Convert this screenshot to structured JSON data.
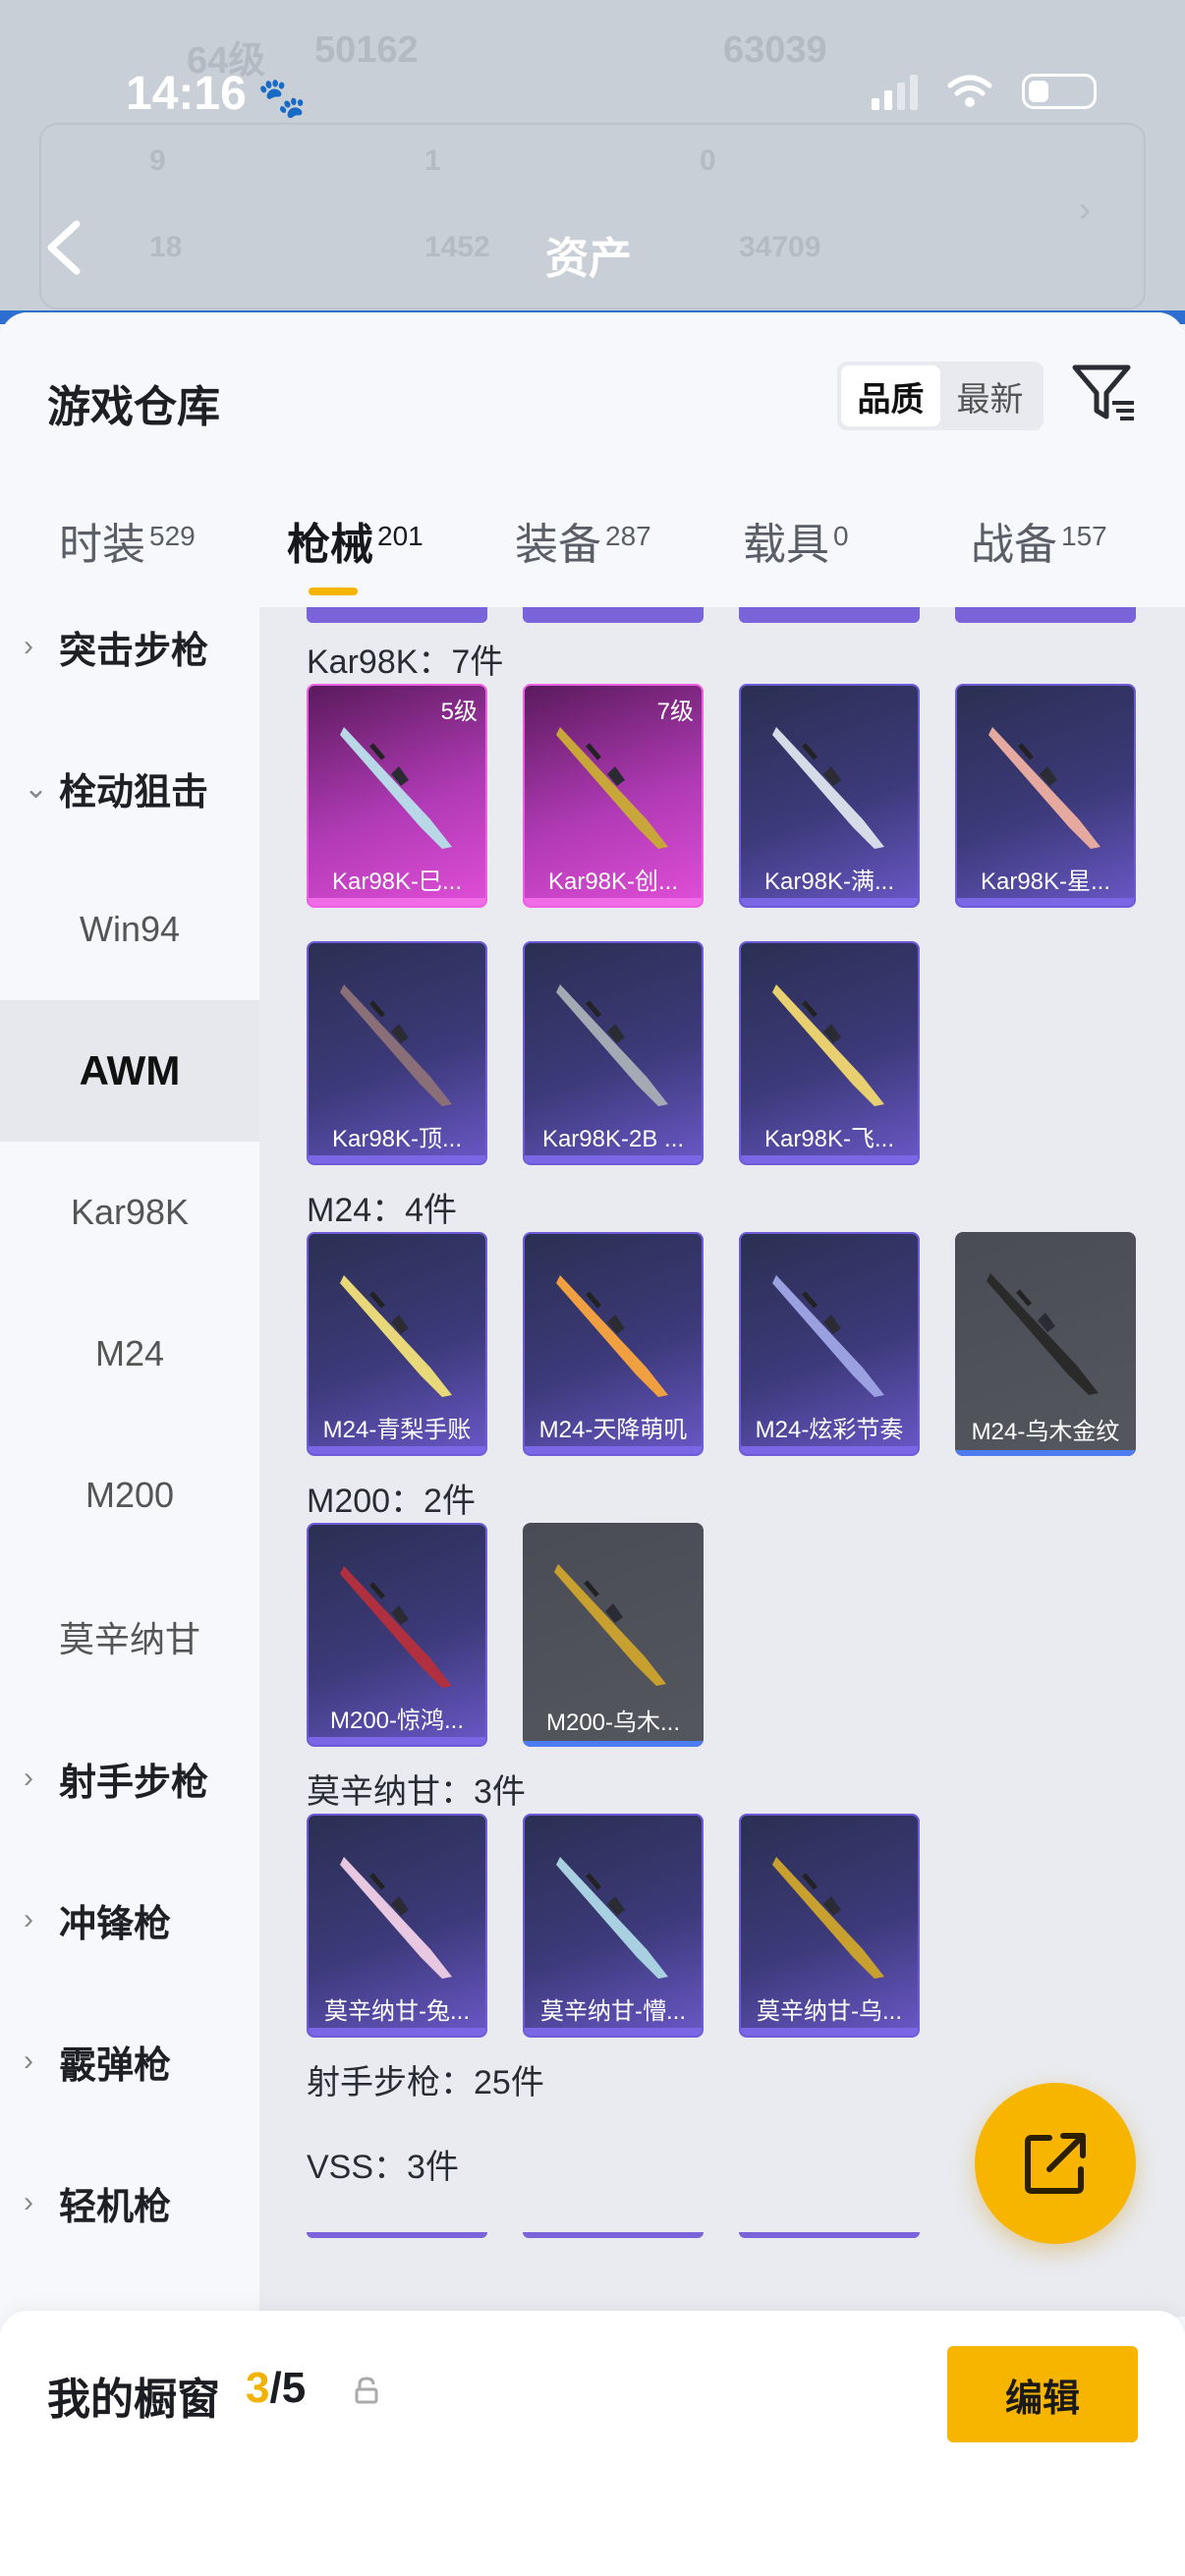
{
  "status_bar": {
    "time": "14:16"
  },
  "background_header": {
    "level": "64级",
    "coins": "50162",
    "other_value": "63039",
    "stats_row1": [
      "9",
      "1",
      "0"
    ],
    "stats_row2": [
      "18",
      "1452",
      "34709"
    ],
    "asset_title": "资产"
  },
  "header": {
    "title": "游戏仓库",
    "sort_options": [
      "品质",
      "最新"
    ]
  },
  "tabs": [
    {
      "label": "时装",
      "count": "529"
    },
    {
      "label": "枪械",
      "count": "201"
    },
    {
      "label": "装备",
      "count": "287"
    },
    {
      "label": "载具",
      "count": "0"
    },
    {
      "label": "战备",
      "count": "157"
    }
  ],
  "sidebar": [
    {
      "label": "突击步枪",
      "type": "category",
      "expanded": false
    },
    {
      "label": "栓动狙击",
      "type": "category",
      "expanded": true
    },
    {
      "label": "Win94",
      "type": "sub"
    },
    {
      "label": "AWM",
      "type": "sub",
      "selected": true
    },
    {
      "label": "Kar98K",
      "type": "sub"
    },
    {
      "label": "M24",
      "type": "sub"
    },
    {
      "label": "M200",
      "type": "sub"
    },
    {
      "label": "莫辛纳甘",
      "type": "sub"
    },
    {
      "label": "射手步枪",
      "type": "category",
      "expanded": false
    },
    {
      "label": "冲锋枪",
      "type": "category",
      "expanded": false
    },
    {
      "label": "霰弹枪",
      "type": "category",
      "expanded": false
    },
    {
      "label": "轻机枪",
      "type": "category",
      "expanded": false
    }
  ],
  "sections": [
    {
      "title": "Kar98K：7件",
      "items": [
        {
          "name": "Kar98K-巳...",
          "style": "pink",
          "level": "5级",
          "gun_color": "#b8d8e8"
        },
        {
          "name": "Kar98K-创...",
          "style": "pink",
          "level": "7级",
          "gun_color": "#c9a63a"
        },
        {
          "name": "Kar98K-满...",
          "style": "purple",
          "gun_color": "#d6dbe8"
        },
        {
          "name": "Kar98K-星...",
          "style": "purple",
          "gun_color": "#e6a9a0"
        },
        {
          "name": "Kar98K-顶...",
          "style": "purple",
          "gun_color": "#8a6e78"
        },
        {
          "name": "Kar98K-2B ...",
          "style": "purple",
          "gun_color": "#a4aab4"
        },
        {
          "name": "Kar98K-飞...",
          "style": "purple",
          "gun_color": "#e8d070"
        }
      ]
    },
    {
      "title": "M24：4件",
      "items": [
        {
          "name": "M24-青梨手账",
          "style": "purple",
          "gun_color": "#e8d87a"
        },
        {
          "name": "M24-天降萌叽",
          "style": "purple",
          "gun_color": "#f0a040"
        },
        {
          "name": "M24-炫彩节奏",
          "style": "purple",
          "gun_color": "#9aa0e0"
        },
        {
          "name": "M24-乌木金纹",
          "style": "grey",
          "gun_color": "#2a2a2a"
        }
      ]
    },
    {
      "title": "M200：2件",
      "items": [
        {
          "name": "M200-惊鸿...",
          "style": "purple",
          "gun_color": "#b03040"
        },
        {
          "name": "M200-乌木...",
          "style": "grey",
          "gun_color": "#c8a030"
        }
      ]
    },
    {
      "title": "莫辛纳甘：3件",
      "items": [
        {
          "name": "莫辛纳甘-兔...",
          "style": "purple",
          "gun_color": "#e8c8e0"
        },
        {
          "name": "莫辛纳甘-懵...",
          "style": "purple",
          "gun_color": "#a8d0e0"
        },
        {
          "name": "莫辛纳甘-乌...",
          "style": "purple",
          "gun_color": "#c8a030"
        }
      ]
    },
    {
      "title": "射手步枪：25件",
      "items": []
    },
    {
      "title": "VSS：3件",
      "items": []
    }
  ],
  "showcase": {
    "label": "我的橱窗",
    "current": "3",
    "total": "/5",
    "edit_label": "编辑"
  }
}
